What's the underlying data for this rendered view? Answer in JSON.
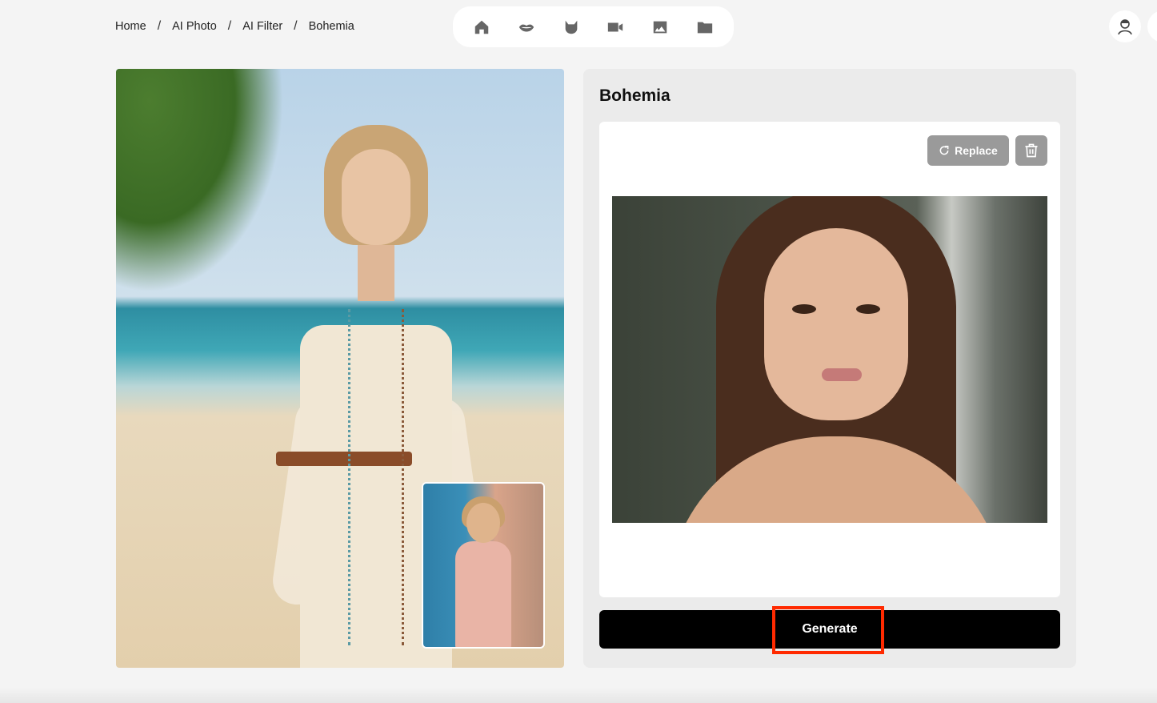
{
  "breadcrumb": {
    "items": [
      "Home",
      "AI Photo",
      "AI Filter",
      "Bohemia"
    ],
    "separator": "/"
  },
  "top_nav": {
    "icons": [
      "home-icon",
      "lips-icon",
      "cat-icon",
      "video-icon",
      "image-icon",
      "folder-icon"
    ]
  },
  "panel": {
    "title": "Bohemia",
    "replace_label": "Replace",
    "generate_label": "Generate"
  },
  "colors": {
    "highlight": "#ff2a00",
    "generate_bg": "#000000",
    "secondary_button": "#9a9a9a"
  }
}
